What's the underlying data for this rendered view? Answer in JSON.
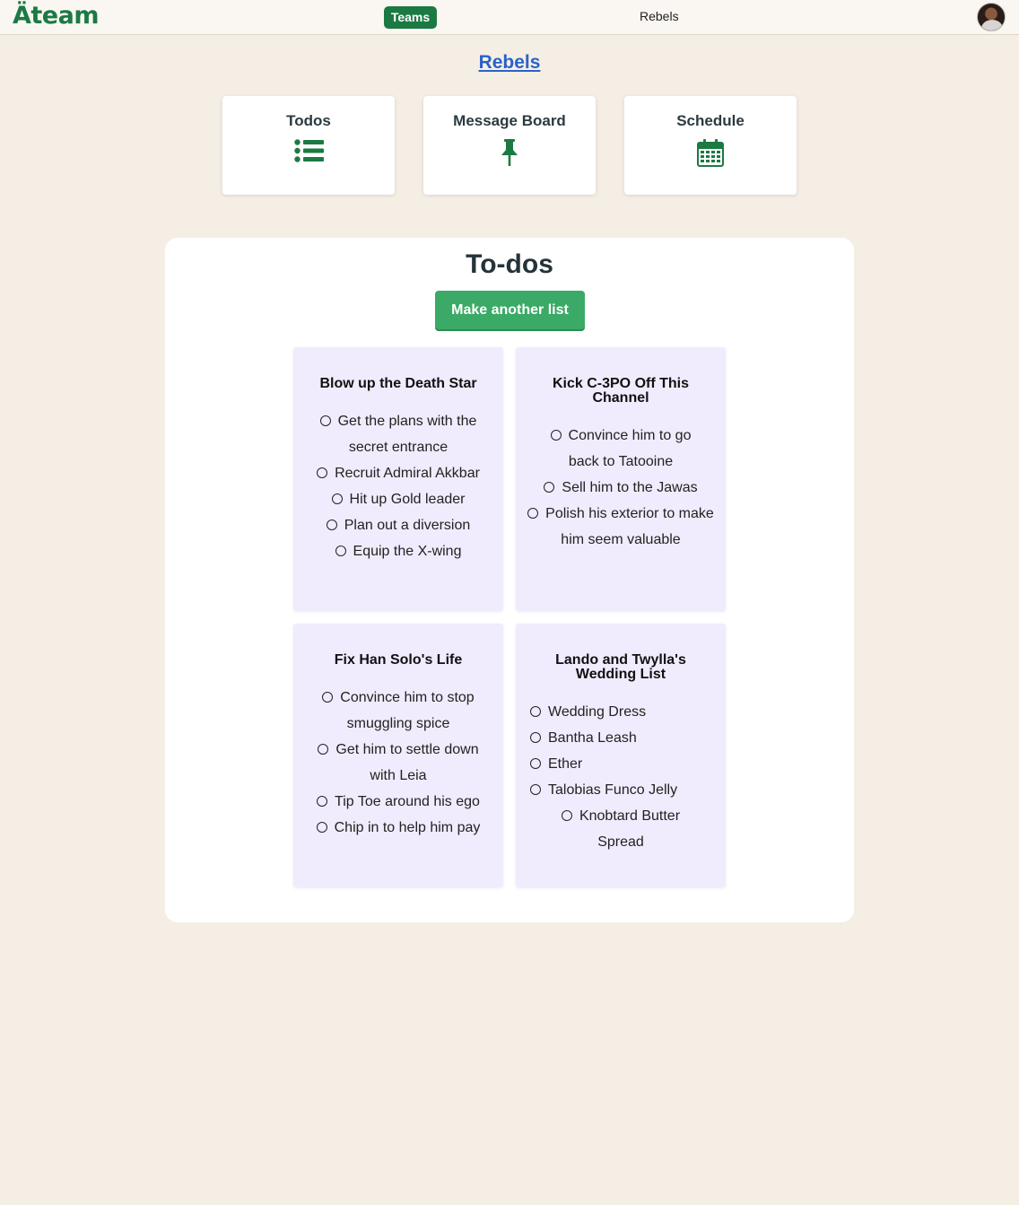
{
  "nav": {
    "logo": "Äteam",
    "teams_label": "Teams",
    "team_name": "Rebels"
  },
  "team": {
    "title": "Rebels"
  },
  "tools": [
    {
      "label": "Todos",
      "icon": "list-icon"
    },
    {
      "label": "Message Board",
      "icon": "pushpin-icon"
    },
    {
      "label": "Schedule",
      "icon": "calendar-icon"
    }
  ],
  "todos": {
    "heading": "To-dos",
    "make_list_label": "Make another list",
    "lists": [
      {
        "title": "Blow up the Death Star",
        "items": [
          "Get the plans with the secret entrance",
          "Recruit Admiral Akkbar",
          "Hit up Gold leader",
          "Plan out a diversion",
          "Equip the X-wing"
        ]
      },
      {
        "title": "Kick C-3PO Off This Channel",
        "items": [
          "Convince him to go back to Tatooine",
          "Sell him to the Jawas",
          "Polish his exterior to make him seem valuable"
        ]
      },
      {
        "title": "Fix Han Solo's Life",
        "items": [
          "Convince him to stop smuggling spice",
          "Get him to settle down with Leia",
          "Tip Toe around his ego",
          "Chip in to help him pay"
        ]
      },
      {
        "title": "Lando and Twylla's Wedding List",
        "items": [
          "Wedding Dress",
          "Bantha Leash",
          "Ether",
          "Talobias Funco Jelly",
          "Knobtard Butter Spread"
        ]
      }
    ]
  },
  "colors": {
    "brand_green": "#1b7a43",
    "button_green": "#3aaa66",
    "link_blue": "#2a62c9",
    "list_bg": "#f0ecfe",
    "page_bg": "#f5eee5"
  }
}
